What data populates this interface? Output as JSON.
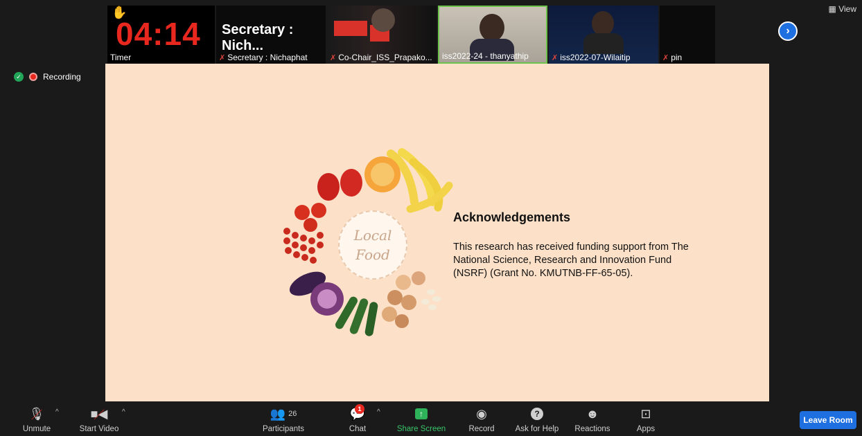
{
  "top_strip": {
    "timer": {
      "digits": "04:14",
      "label": "Timer"
    },
    "tiles": [
      {
        "heading": "Secretary : Nich...",
        "label": "Secretary : Nichaphat"
      },
      {
        "label": "Co-Chair_ISS_Prapako..."
      },
      {
        "label": "iss2022-24 - thanyathip"
      },
      {
        "label": "iss2022-07-Wilaitip"
      },
      {
        "label": "pin"
      }
    ],
    "view_label": "View"
  },
  "recording": {
    "label": "Recording"
  },
  "slide": {
    "title": "Acknowledgements",
    "body": "This research has received funding support from The National Science, Research and Innovation Fund (NSRF) (Grant No. KMUTNB-FF-65-05).",
    "badge_line1": "Local",
    "badge_line2": "Food"
  },
  "toolbar": {
    "unmute": "Unmute",
    "start_video": "Start Video",
    "participants": "Participants",
    "participants_count": "26",
    "chat": "Chat",
    "chat_badge": "1",
    "share_screen": "Share Screen",
    "record": "Record",
    "ask_for_help": "Ask for Help",
    "reactions": "Reactions",
    "apps": "Apps",
    "leave_room": "Leave Room"
  },
  "colors": {
    "accent": "#1e6fe0",
    "share_green": "#2fb35a",
    "timer_red": "#e8281f",
    "slide_bg": "#fce1c8"
  }
}
